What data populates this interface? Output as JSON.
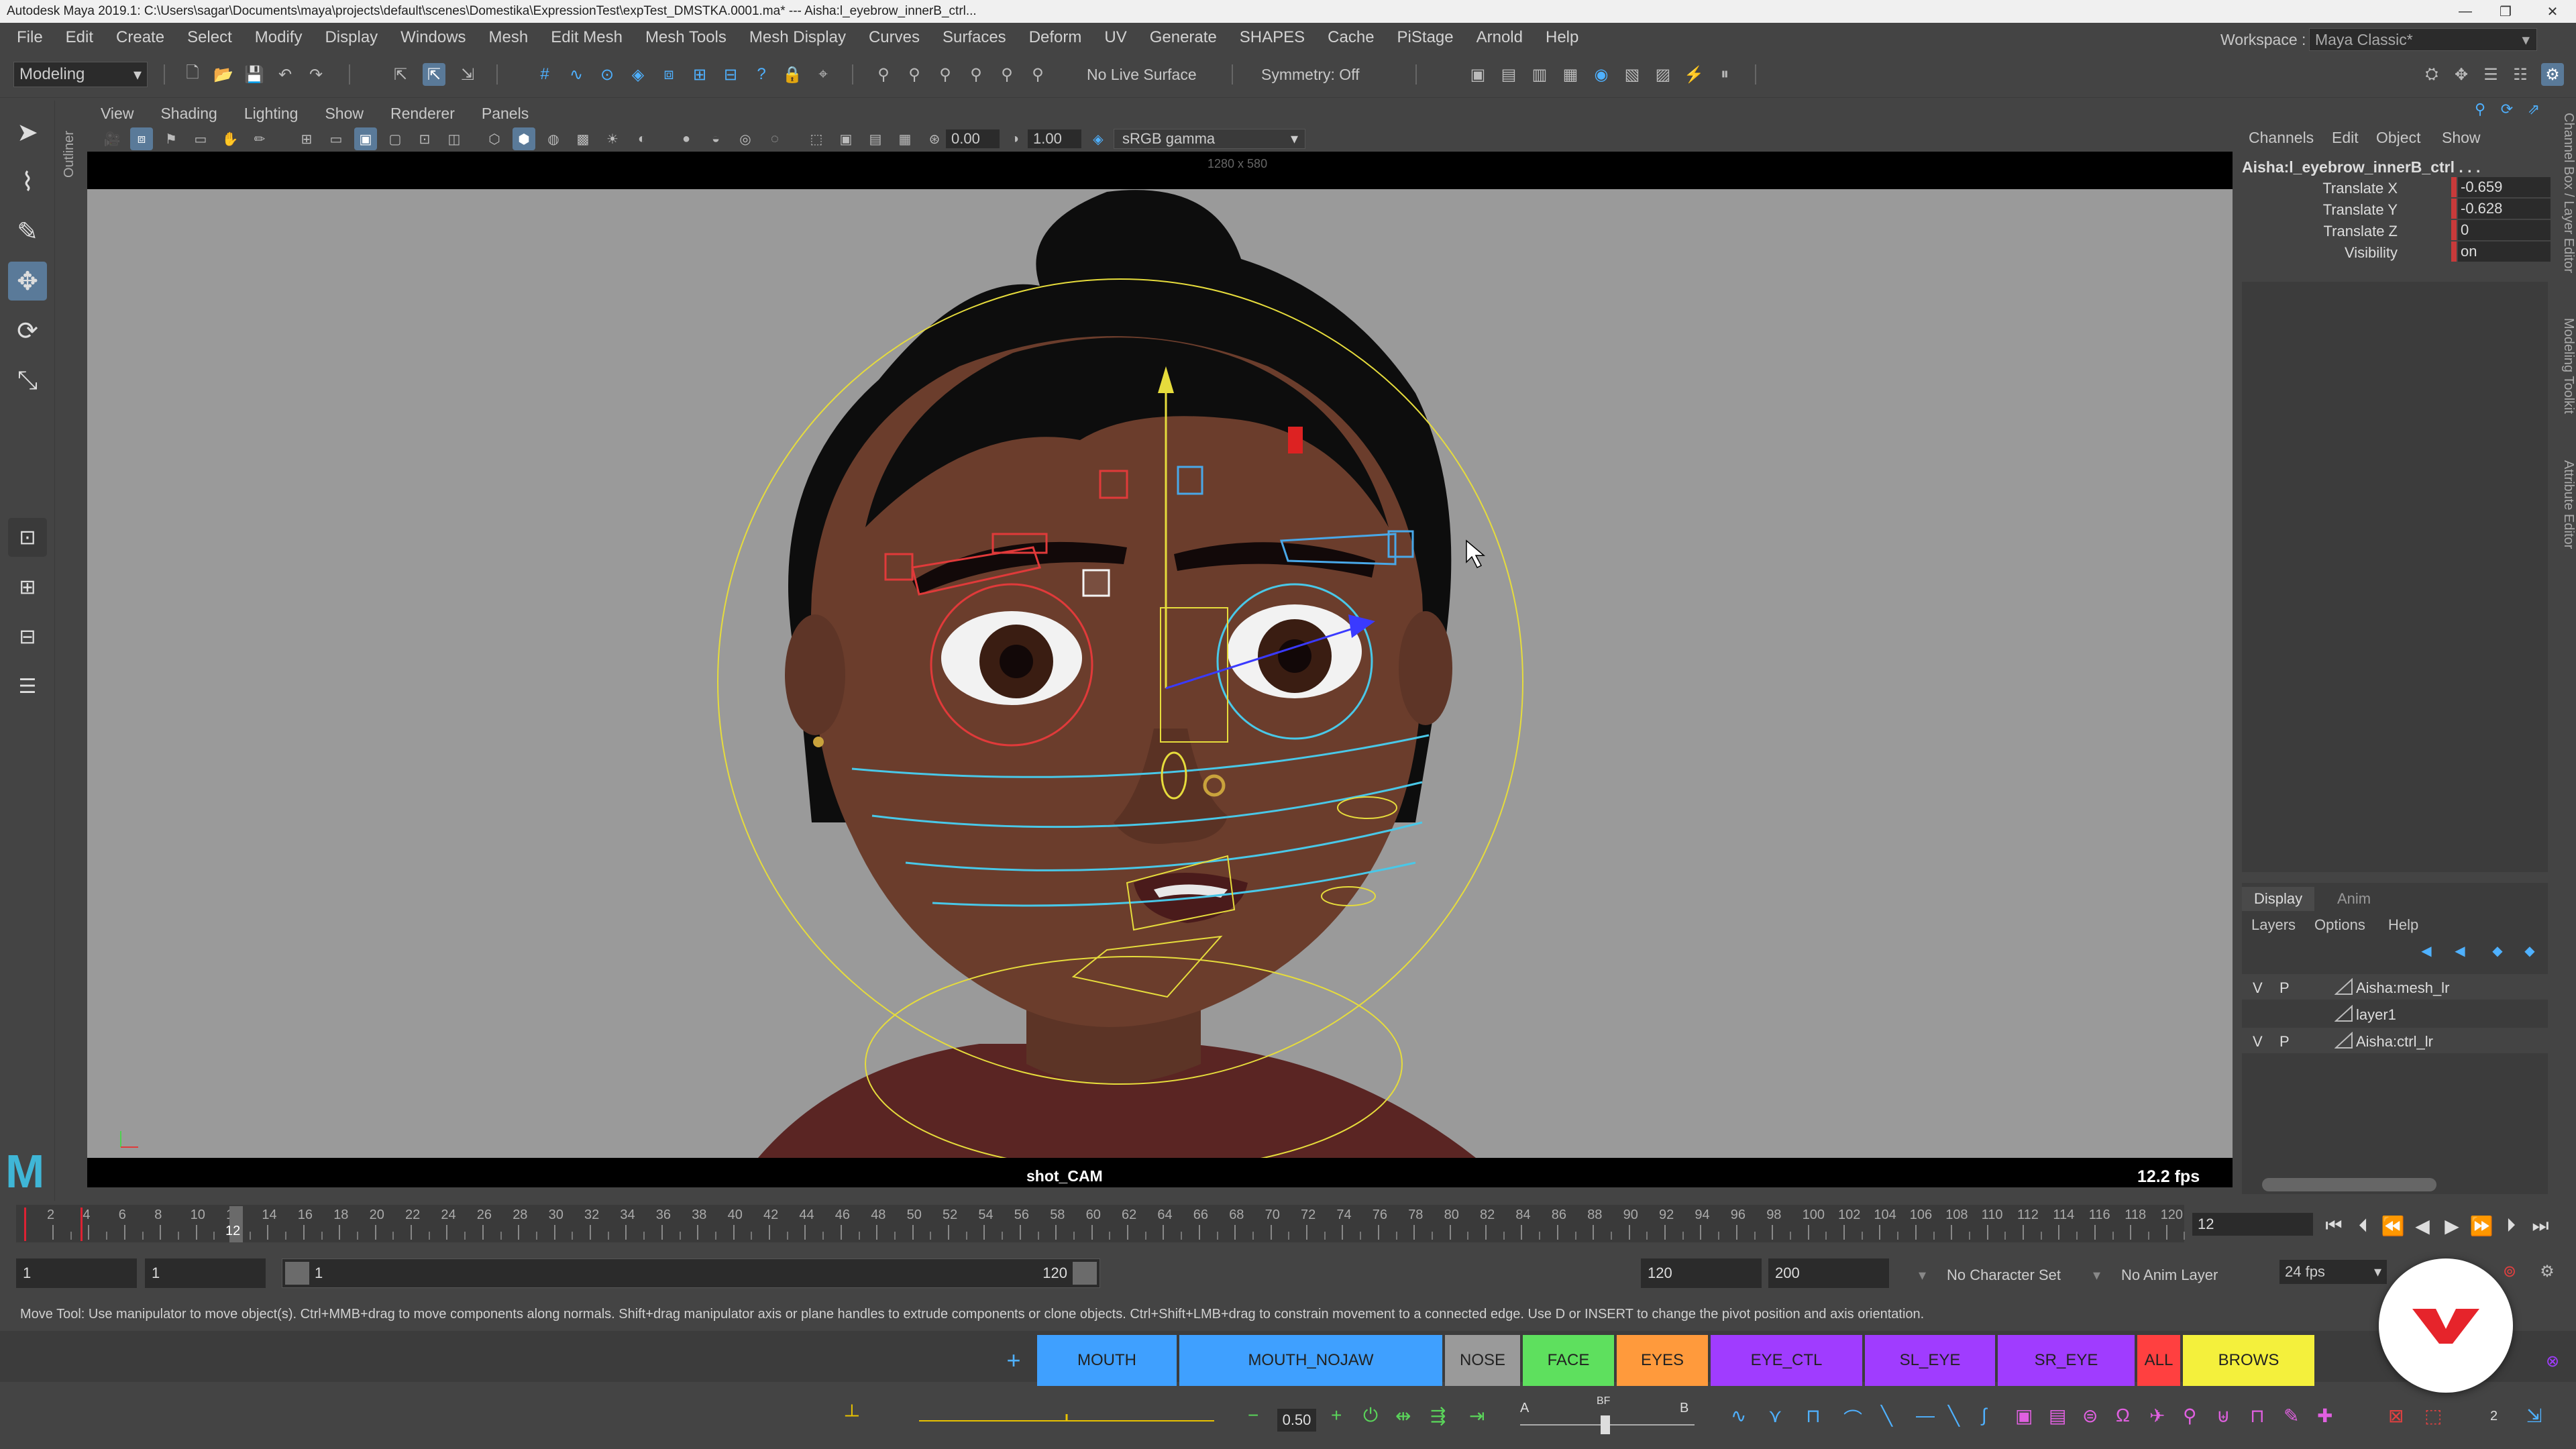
{
  "window": {
    "title": "Autodesk Maya 2019.1: C:\\Users\\sagar\\Documents\\maya\\projects\\default\\scenes\\Domestika\\ExpressionTest\\expTest_DMSTKA.0001.ma*   ---   Aisha:l_eyebrow_innerB_ctrl...",
    "controls": [
      "—",
      "❐",
      "✕"
    ]
  },
  "menubar": {
    "items": [
      "File",
      "Edit",
      "Create",
      "Select",
      "Modify",
      "Display",
      "Windows",
      "Mesh",
      "Edit Mesh",
      "Mesh Tools",
      "Mesh Display",
      "Curves",
      "Surfaces",
      "Deform",
      "UV",
      "Generate",
      "SHAPES",
      "Cache",
      "PiStage",
      "Arnold",
      "Help"
    ],
    "workspace_label": "Workspace :",
    "workspace_value": "Maya Classic*"
  },
  "statusline": {
    "mode": "Modeling",
    "live_surface": "No Live Surface",
    "symmetry": "Symmetry: Off"
  },
  "outliner_tab": "Outliner",
  "viewport": {
    "menus": [
      "View",
      "Shading",
      "Lighting",
      "Show",
      "Renderer",
      "Panels"
    ],
    "exposure": "0.00",
    "gamma": "1.00",
    "color_space": "sRGB gamma",
    "resolution_gate": "1280 x 580",
    "camera": "shot_CAM",
    "fps": "12.2 fps"
  },
  "channel_box": {
    "menus": [
      "Channels",
      "Edit",
      "Object",
      "Show"
    ],
    "object": "Aisha:l_eyebrow_innerB_ctrl . . .",
    "channels": [
      {
        "label": "Translate X",
        "value": "-0.659"
      },
      {
        "label": "Translate Y",
        "value": "-0.628"
      },
      {
        "label": "Translate Z",
        "value": "0"
      },
      {
        "label": "Visibility",
        "value": "on"
      }
    ]
  },
  "side_tabs": [
    "Channel Box / Layer Editor",
    "Modeling Toolkit",
    "Attribute Editor"
  ],
  "layer_editor": {
    "tabs": [
      "Display",
      "Anim"
    ],
    "menus": [
      "Layers",
      "Options",
      "Help"
    ],
    "layers": [
      {
        "v": "V",
        "p": "P",
        "name": "Aisha:mesh_lr"
      },
      {
        "v": "",
        "p": "",
        "name": "layer1"
      },
      {
        "v": "V",
        "p": "P",
        "name": "Aisha:ctrl_lr"
      }
    ]
  },
  "timeline": {
    "ticks": [
      "2",
      "4",
      "6",
      "8",
      "10",
      "12",
      "14",
      "16",
      "18",
      "20",
      "22",
      "24",
      "26",
      "28",
      "30",
      "32",
      "34",
      "36",
      "38",
      "40",
      "42",
      "44",
      "46",
      "48",
      "50",
      "52",
      "54",
      "56",
      "58",
      "60",
      "62",
      "64",
      "66",
      "68",
      "70",
      "72",
      "74",
      "76",
      "78",
      "80",
      "82",
      "84",
      "86",
      "88",
      "90",
      "92",
      "94",
      "96",
      "98",
      "100",
      "102",
      "104",
      "106",
      "108",
      "110",
      "112",
      "114",
      "116",
      "118",
      "120"
    ],
    "current_frame": "12",
    "current_marker": "12"
  },
  "range": {
    "start": "1",
    "playback_start": "1",
    "slider_start": "1",
    "slider_end": "120",
    "playback_end": "120",
    "end": "200",
    "character_set": "No Character Set",
    "anim_layer": "No Anim Layer",
    "fps": "24 fps"
  },
  "help_line": "Move Tool: Use manipulator to move object(s). Ctrl+MMB+drag to move components along normals. Shift+drag manipulator axis or plane handles to extrude components or clone objects. Ctrl+Shift+LMB+drag to constrain movement to a connected edge. Use D or INSERT to change the pivot position and axis orientation.",
  "shelf": {
    "add": "+",
    "buttons": [
      {
        "label": "MOUTH",
        "color": "#3fa0ff"
      },
      {
        "label": "MOUTH_NOJAW",
        "color": "#3fa0ff"
      },
      {
        "label": "NOSE",
        "color": "#9a9a9a"
      },
      {
        "label": "FACE",
        "color": "#5ee05e"
      },
      {
        "label": "EYES",
        "color": "#ff9a3c"
      },
      {
        "label": "EYE_CTL",
        "color": "#a03cff"
      },
      {
        "label": "SL_EYE",
        "color": "#a03cff"
      },
      {
        "label": "SR_EYE",
        "color": "#a03cff"
      },
      {
        "label": "ALL",
        "color": "#ff4040"
      },
      {
        "label": "BROWS",
        "color": "#f4f03c"
      }
    ]
  },
  "bottom_bar": {
    "weight": "0.50",
    "a_label": "A",
    "bf_label": "BF",
    "b_label": "B",
    "count": "2"
  },
  "colors": {
    "accent": "#4fb1ff",
    "keyed": "#c83a3a",
    "panel": "#444444"
  }
}
